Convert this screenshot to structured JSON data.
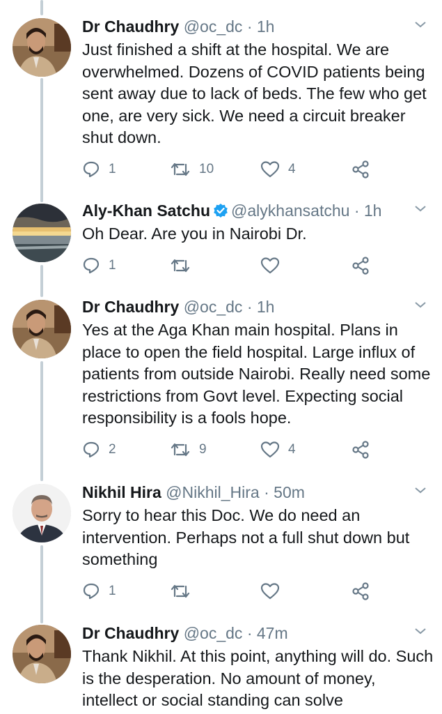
{
  "colors": {
    "text": "#14171a",
    "muted": "#657786",
    "verified": "#1da1f2",
    "thread": "#c4cfd6"
  },
  "tweets": [
    {
      "name": "Dr Chaudhry",
      "handle": "@oc_dc",
      "sep": "·",
      "time": "1h",
      "verified": false,
      "avatar": "doctor-avatar",
      "text": "Just finished a shift at the hospital. We are overwhelmed. Dozens of COVID patients being sent away due to lack of beds. The few who get one, are very sick. We need a circuit breaker shut down.",
      "replies": "1",
      "retweets": "10",
      "likes": "4"
    },
    {
      "name": "Aly-Khan Satchu",
      "handle": "@alykhansatchu",
      "sep": "·",
      "time": "1h",
      "verified": true,
      "avatar": "sunset-avatar",
      "text": "Oh Dear. Are you in Nairobi Dr.",
      "replies": "1",
      "retweets": "",
      "likes": ""
    },
    {
      "name": "Dr Chaudhry",
      "handle": "@oc_dc",
      "sep": "·",
      "time": "1h",
      "verified": false,
      "avatar": "doctor-avatar",
      "text": "Yes at the Aga Khan main hospital. Plans in place to open the field hospital. Large influx of patients from outside Nairobi. Really need some restrictions from Govt level. Expecting social responsibility is a fools hope.",
      "replies": "2",
      "retweets": "9",
      "likes": "4"
    },
    {
      "name": "Nikhil Hira",
      "handle": "@Nikhil_Hira",
      "sep": "·",
      "time": "50m",
      "verified": false,
      "avatar": "suited-man-avatar",
      "text": "Sorry to hear this Doc. We do need an intervention. Perhaps not a full shut down but something",
      "replies": "1",
      "retweets": "",
      "likes": ""
    },
    {
      "name": "Dr Chaudhry",
      "handle": "@oc_dc",
      "sep": "·",
      "time": "47m",
      "verified": false,
      "avatar": "doctor-avatar",
      "text": "Thank Nikhil. At this point, anything will do. Such is the desperation. No amount of money, intellect or social standing can solve",
      "replies": "",
      "retweets": "",
      "likes": ""
    }
  ]
}
